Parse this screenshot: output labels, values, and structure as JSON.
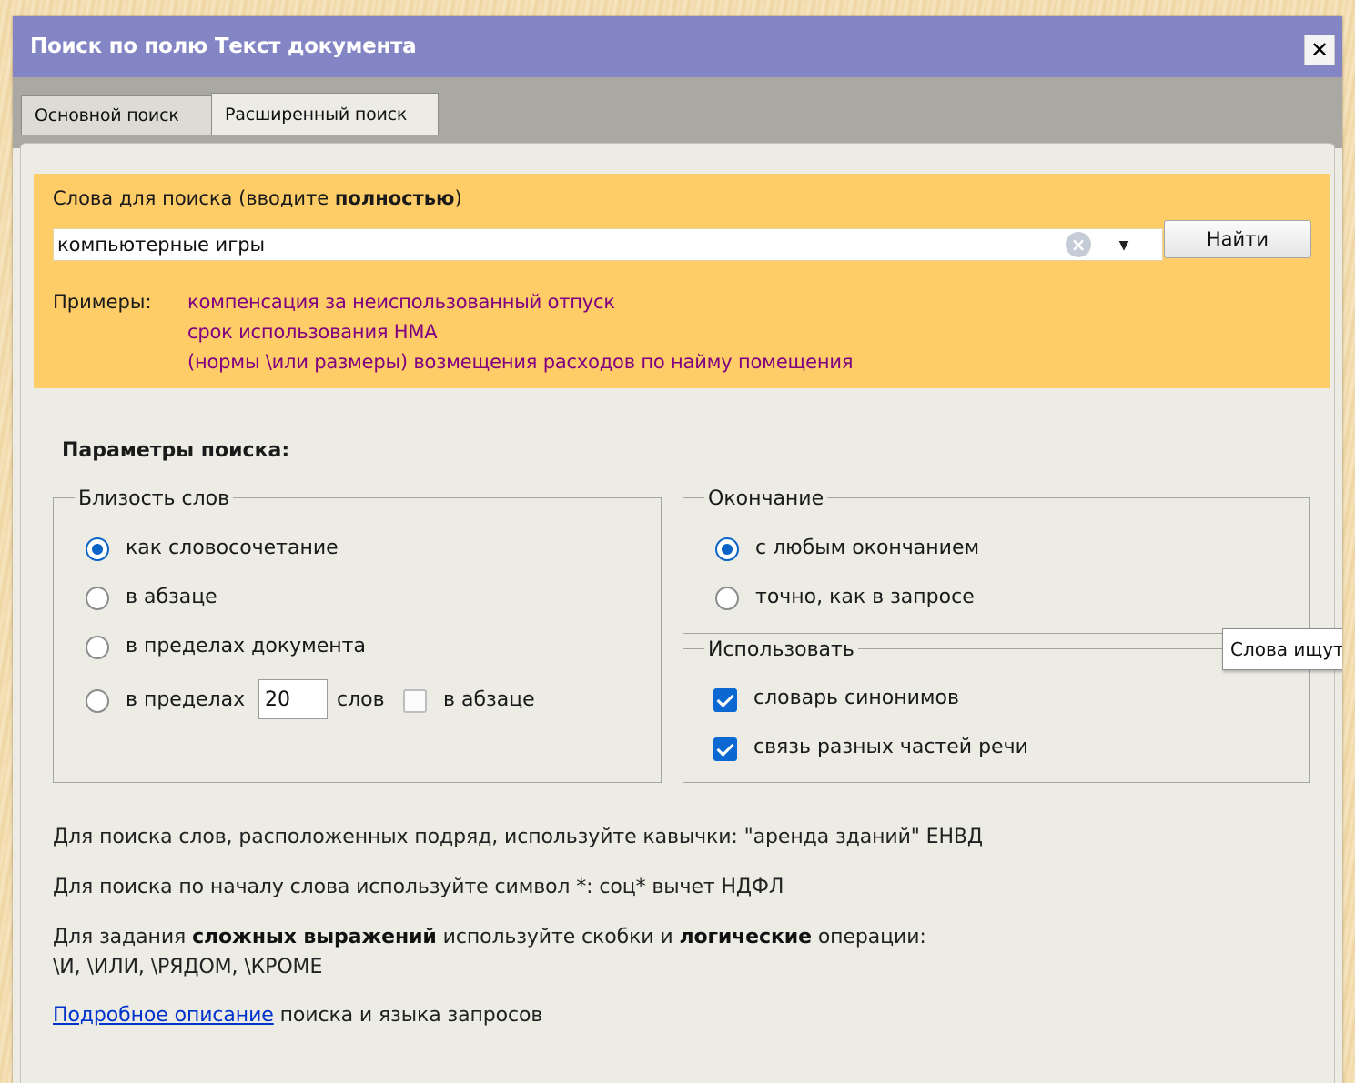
{
  "dialog": {
    "title": "Поиск по полю Текст документа",
    "close_glyph": "✕"
  },
  "tabs": [
    {
      "label": "Основной поиск",
      "active": false
    },
    {
      "label": "Расширенный поиск",
      "active": true
    }
  ],
  "search": {
    "label_prefix": "Слова для поиска (вводите ",
    "label_bold": "полностью",
    "label_suffix": ")",
    "value": "компьютерные игры",
    "find_button": "Найти",
    "examples_label": "Примеры:",
    "examples": [
      "компенсация за неиспользованный отпуск",
      "срок использования НМА",
      "(нормы \\или размеры) возмещения расходов по найму помещения"
    ]
  },
  "params": {
    "title": "Параметры поиска:",
    "proximity": {
      "legend": "Близость слов",
      "options": [
        {
          "label": "как словосочетание",
          "checked": true
        },
        {
          "label": "в абзаце",
          "checked": false
        },
        {
          "label": "в пределах документа",
          "checked": false
        },
        {
          "label": "в пределах",
          "checked": false
        }
      ],
      "words_value": "20",
      "words_label": "слов",
      "in_paragraph_label": "в абзаце",
      "in_paragraph_checked": false
    },
    "ending": {
      "legend": "Окончание",
      "options": [
        {
          "label": "с любым окончанием",
          "checked": true
        },
        {
          "label": "точно, как в запросе",
          "checked": false
        }
      ]
    },
    "use": {
      "legend": "Использовать",
      "options": [
        {
          "label": "словарь синонимов",
          "checked": true
        },
        {
          "label": "связь разных частей речи",
          "checked": true
        }
      ]
    }
  },
  "tooltip": "Слова ищутся",
  "hints": {
    "quotes": "Для поиска слов, расположенных подряд, используйте кавычки: \"аренда зданий\" ЕНВД",
    "prefix": "Для поиска по началу слова используйте символ *: соц* вычет НДФЛ",
    "complex_1": "Для задания ",
    "complex_bold_1": "сложных выражений",
    "complex_2": " используйте скобки и ",
    "complex_bold_2": "логические",
    "complex_3": " операции:",
    "operators": "\\И, \\ИЛИ, \\РЯДОМ, \\КРОМЕ",
    "link_text": "Подробное описание",
    "link_suffix": " поиска и языка запросов"
  },
  "colors": {
    "titlebar": "#8385c4",
    "search_panel": "#fecd67",
    "example_text": "#800080",
    "accent": "#0b67d1",
    "link": "#0033cc"
  }
}
